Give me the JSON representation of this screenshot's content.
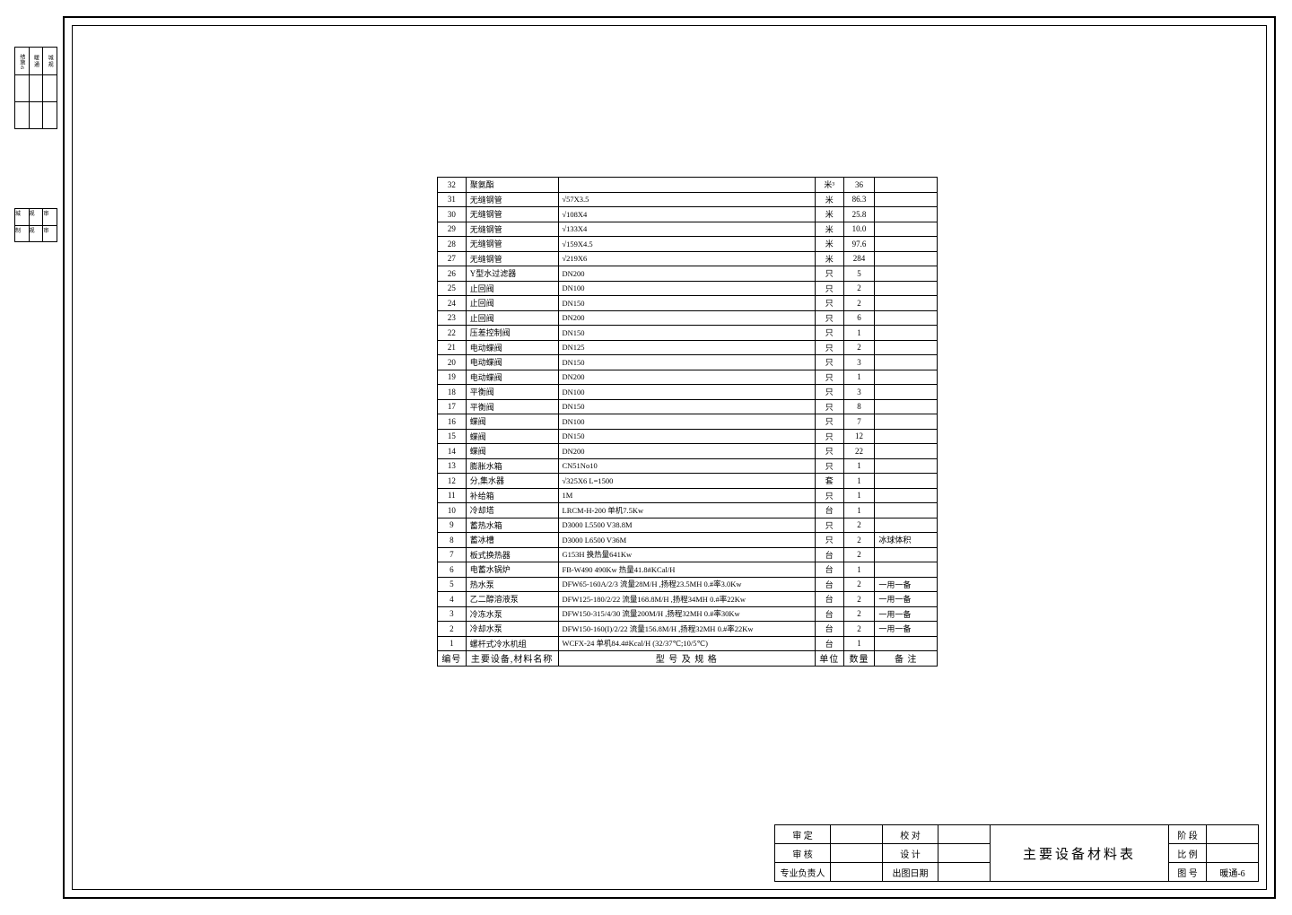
{
  "side_block_1": {
    "cells": [
      "结施-6",
      "暖 通",
      "城 规"
    ]
  },
  "side_block_2": {
    "cells": [
      "城",
      "规",
      "审",
      "制",
      "规",
      "审"
    ]
  },
  "table": {
    "header": {
      "no": "编号",
      "name": "主要设备,材料名称",
      "spec": "型 号 及 规 格",
      "unit": "单位",
      "qty": "数量",
      "remark": "备 注"
    },
    "rows": [
      {
        "no": "32",
        "name": "聚氨酯",
        "spec": "",
        "unit": "米³",
        "qty": "36",
        "remark": ""
      },
      {
        "no": "31",
        "name": "无缝钢管",
        "spec": "√57X3.5",
        "unit": "米",
        "qty": "86.3",
        "remark": ""
      },
      {
        "no": "30",
        "name": "无缝钢管",
        "spec": "√108X4",
        "unit": "米",
        "qty": "25.8",
        "remark": ""
      },
      {
        "no": "29",
        "name": "无缝钢管",
        "spec": "√133X4",
        "unit": "米",
        "qty": "10.0",
        "remark": ""
      },
      {
        "no": "28",
        "name": "无缝钢管",
        "spec": "√159X4.5",
        "unit": "米",
        "qty": "97.6",
        "remark": ""
      },
      {
        "no": "27",
        "name": "无缝钢管",
        "spec": "√219X6",
        "unit": "米",
        "qty": "284",
        "remark": ""
      },
      {
        "no": "26",
        "name": "Y型水过滤器",
        "spec": "DN200",
        "unit": "只",
        "qty": "5",
        "remark": ""
      },
      {
        "no": "25",
        "name": "止回阀",
        "spec": "DN100",
        "unit": "只",
        "qty": "2",
        "remark": ""
      },
      {
        "no": "24",
        "name": "止回阀",
        "spec": "DN150",
        "unit": "只",
        "qty": "2",
        "remark": ""
      },
      {
        "no": "23",
        "name": "止回阀",
        "spec": "DN200",
        "unit": "只",
        "qty": "6",
        "remark": ""
      },
      {
        "no": "22",
        "name": "压差控制阀",
        "spec": "DN150",
        "unit": "只",
        "qty": "1",
        "remark": ""
      },
      {
        "no": "21",
        "name": "电动蝶阀",
        "spec": "DN125",
        "unit": "只",
        "qty": "2",
        "remark": ""
      },
      {
        "no": "20",
        "name": "电动蝶阀",
        "spec": "DN150",
        "unit": "只",
        "qty": "3",
        "remark": ""
      },
      {
        "no": "19",
        "name": "电动蝶阀",
        "spec": "DN200",
        "unit": "只",
        "qty": "1",
        "remark": ""
      },
      {
        "no": "18",
        "name": "平衡阀",
        "spec": "DN100",
        "unit": "只",
        "qty": "3",
        "remark": ""
      },
      {
        "no": "17",
        "name": "平衡阀",
        "spec": "DN150",
        "unit": "只",
        "qty": "8",
        "remark": ""
      },
      {
        "no": "16",
        "name": "蝶阀",
        "spec": "DN100",
        "unit": "只",
        "qty": "7",
        "remark": ""
      },
      {
        "no": "15",
        "name": "蝶阀",
        "spec": "DN150",
        "unit": "只",
        "qty": "12",
        "remark": ""
      },
      {
        "no": "14",
        "name": "蝶阀",
        "spec": "DN200",
        "unit": "只",
        "qty": "22",
        "remark": ""
      },
      {
        "no": "13",
        "name": "膨胀水箱",
        "spec": "CN51No10",
        "unit": "只",
        "qty": "1",
        "remark": ""
      },
      {
        "no": "12",
        "name": "分,集水器",
        "spec": "√325X6  L=1500",
        "unit": "套",
        "qty": "1",
        "remark": ""
      },
      {
        "no": "11",
        "name": "补给箱",
        "spec": "1M",
        "unit": "只",
        "qty": "1",
        "remark": ""
      },
      {
        "no": "10",
        "name": "冷却塔",
        "spec": "LRCM-H-200 单机7.5Kw",
        "unit": "台",
        "qty": "1",
        "remark": ""
      },
      {
        "no": "9",
        "name": "蓄热水箱",
        "spec": "D3000 L5500 V38.8M",
        "unit": "只",
        "qty": "2",
        "remark": ""
      },
      {
        "no": "8",
        "name": "蓄冰槽",
        "spec": "D3000 L6500 V36M",
        "unit": "只",
        "qty": "2",
        "remark": "冰球体积"
      },
      {
        "no": "7",
        "name": "板式换热器",
        "spec": "G153H 换热量641Kw",
        "unit": "台",
        "qty": "2",
        "remark": ""
      },
      {
        "no": "6",
        "name": "电蓄水锅炉",
        "spec": "FB-W490 490Kw  热量41.8#KCal/H",
        "unit": "台",
        "qty": "1",
        "remark": ""
      },
      {
        "no": "5",
        "name": "热水泵",
        "spec": "DFW65-160A/2/3 流量28M/H ,扬程23.5MH 0.#率3.0Kw",
        "unit": "台",
        "qty": "2",
        "remark": "一用一备"
      },
      {
        "no": "4",
        "name": "乙二醇溶液泵",
        "spec": "DFW125-180/2/22 流量168.8M/H ,扬程34MH 0.#率22Kw",
        "unit": "台",
        "qty": "2",
        "remark": "一用一备"
      },
      {
        "no": "3",
        "name": "冷冻水泵",
        "spec": "DFW150-315/4/30 流量200M/H ,扬程32MH 0.#率30Kw",
        "unit": "台",
        "qty": "2",
        "remark": "一用一备"
      },
      {
        "no": "2",
        "name": "冷却水泵",
        "spec": "DFW150-160(I)/2/22 流量156.8M/H ,扬程32MH 0.#率22Kw",
        "unit": "台",
        "qty": "2",
        "remark": "一用一备"
      },
      {
        "no": "1",
        "name": "螺杆式冷水机组",
        "spec": "WCFX-24  单机84.4#Kcal/H   (32/37℃;10/5℃)",
        "unit": "台",
        "qty": "1",
        "remark": ""
      }
    ]
  },
  "title_block": {
    "row1": {
      "l1": "审 定",
      "v1": "",
      "l2": "校 对",
      "v2": "",
      "r_lbl": "阶 段",
      "r_val": ""
    },
    "row2": {
      "l1": "审 核",
      "v1": "",
      "l2": "设 计",
      "v2": "",
      "r_lbl": "比 例",
      "r_val": ""
    },
    "row3": {
      "l1": "专业负责人",
      "v1": "",
      "l2": "出图日期",
      "v2": "",
      "r_lbl": "图 号",
      "r_val": "暖通-6"
    },
    "title": "主要设备材料表"
  }
}
